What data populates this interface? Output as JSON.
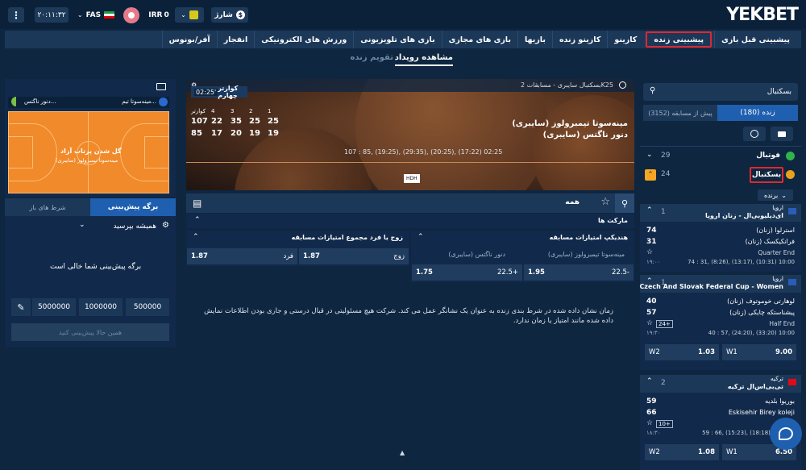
{
  "topbar": {
    "menu": "⋮",
    "time": "۲۰:۱۱:۳۲",
    "lang": "FAS",
    "flag_colors": [
      "#239f40",
      "#ffffff",
      "#da0000"
    ],
    "currency": "IRR",
    "balance": "0",
    "deposit": "شارژ",
    "deposit_icon": "$",
    "logo": "YEKBET"
  },
  "nav": [
    "پیشبینی قبل بازی",
    "پیشبینی زنده",
    "کازینو",
    "کازینو زنده",
    "بازیها",
    "بازی های مجازی",
    "بازی های تلویزیونی",
    "ورزش های الکترونیکی",
    "انفجار",
    "آفر/بونوس"
  ],
  "subnav": {
    "overview": "مشاهده رویداد",
    "calendar": "تقویم زنده"
  },
  "sidebar": {
    "search_placeholder": "بسکتبال",
    "tab_live": "زنده (180)",
    "tab_pre": "پیش از مسابقه (3152)",
    "sports": [
      {
        "name": "فوتبال",
        "count": "29"
      },
      {
        "name": "بسکتبال",
        "count": "24"
      }
    ],
    "filter": "برنده",
    "leagues": [
      {
        "country": "اروپا",
        "name": "ای‌دیلیوبی‌ال - زنان اروپا",
        "count": "1",
        "team1": "استرلوا (زنان)",
        "team2": "فرانکیکسک (زنان)",
        "score1": "74",
        "score2": "31",
        "status": "Quarter End",
        "time": "۱۹:۰۰",
        "scores": "74 : 31, (8:26), (13:17), (10:31) 10:00",
        "markets": ""
      },
      {
        "country": "اروپا",
        "name": "Czech And Slovak Federal Cup - Women",
        "count": "1",
        "team1": "لوهارتی خوموتوف (زنان)",
        "team2": "پیشناستکه چایکی (زنان)",
        "score1": "40",
        "score2": "57",
        "status": "Half End",
        "time": "۱۹:۳۰",
        "scores": "40 : 57, (24:20), (33:20) 10:00",
        "markets": "24+",
        "odds": [
          {
            "label": "W1",
            "value": "9.00"
          },
          {
            "label": "W2",
            "value": "1.03"
          }
        ]
      },
      {
        "country": "ترکیه",
        "name": "تی‌بی‌اس‌ال ترکیه",
        "count": "2",
        "team1": "بوریوا بلدیه",
        "team2": "Eskisehir Birey koleji",
        "score1": "59",
        "score2": "66",
        "status": "چهارم",
        "time": "۱۸:۳۰",
        "scores": "59 : 66, (15:23), (18:18), (24:22)",
        "markets": "10+",
        "odds": [
          {
            "label": "W1",
            "value": "6.50"
          },
          {
            "label": "W2",
            "value": "1.08"
          }
        ]
      }
    ]
  },
  "event": {
    "sport_label": "بسکتبال سایبری - مسابقات 2K25",
    "team1": "مینه‌سوتا تیمبرولوز (سایبری)",
    "team2": "دنور ناگتس (سایبری)",
    "period": "کوارتر چهارم",
    "clock": "02:25'",
    "detail1": "107 : 85, (19:25), (29:35), (20:25), (17:22) 02:25",
    "hd": "HDH",
    "score_headers": [
      "کوارتر",
      "4",
      "3",
      "2",
      "1"
    ],
    "score_row1": [
      "107",
      "22",
      "35",
      "25",
      "25"
    ],
    "score_row2": [
      "85",
      "17",
      "20",
      "19",
      "19"
    ]
  },
  "markets": {
    "filter_all": "همه",
    "section": "مارکت ها",
    "hcp_title": "هندیکپ امتیازات مسابقه",
    "hcp_col1": "مینه‌سوتا تیمبرولوز (سایبری)",
    "hcp_col2": "دنور ناگتس (سایبری)",
    "hcp_row": [
      {
        "label": "22.5-",
        "value": "1.95"
      },
      {
        "label": "22.5+",
        "value": "1.75"
      }
    ],
    "oe_title": "زوج یا فرد مجموع امتیازات مسابقه",
    "oe_row": [
      {
        "label": "زوج",
        "value": "1.87"
      },
      {
        "label": "فرد",
        "value": "1.87"
      }
    ],
    "disclaimer": "زمان نشان داده شده در شرط بندی زنده به عنوان یک نشانگر عمل می کند. شرکت هیچ مسئولیتی در قبال درستی و جاری بودن اطلاعات نمایش داده شده مانند امتیاز یا زمان ندارد."
  },
  "tracker": {
    "team1": "مینه‌سوتا تیم...",
    "team2": "دنور ناگتس...",
    "field_text": "گل شدن پرتاب آزاد",
    "field_sub": "مینه‌سوتا تیمبرولوز (سایبری)",
    "court_color": "#f08a2a"
  },
  "betslip": {
    "tab_slip": "برگه پیش‌بینی",
    "tab_open": "شرط های باز",
    "always_ask": "همیشه بپرسید",
    "empty": "برگه پیش‌بینی شما خالی است",
    "stakes": [
      "500000",
      "1000000",
      "5000000"
    ],
    "place": "همین حالا پیش‌بینی کنید"
  }
}
